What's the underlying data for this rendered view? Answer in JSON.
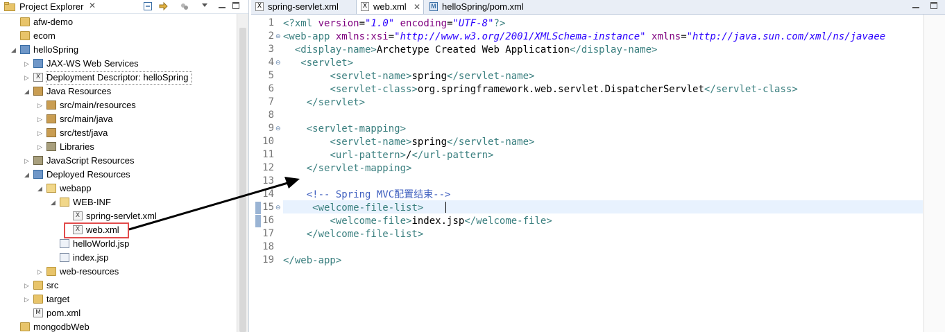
{
  "explorer": {
    "title": "Project Explorer",
    "close_glyph": "✕",
    "toolbar": [
      "collapse-all-icon",
      "link-with-editor-icon",
      "view-menu-icon",
      "minimize-icon",
      "maximize-icon"
    ],
    "items": [
      {
        "label": "afw-demo",
        "icon": "folder-icon",
        "indent": 0,
        "twisty": ""
      },
      {
        "label": "ecom",
        "icon": "folder-icon",
        "indent": 0,
        "twisty": ""
      },
      {
        "label": "helloSpring",
        "icon": "project-icon",
        "indent": 0,
        "twisty": "open"
      },
      {
        "label": "JAX-WS Web Services",
        "icon": "web-services-icon",
        "indent": 1,
        "twisty": "closed"
      },
      {
        "label": "Deployment Descriptor: helloSpring",
        "icon": "deployment-descriptor-icon",
        "indent": 1,
        "twisty": "closed"
      },
      {
        "label": "Java Resources",
        "icon": "java-resources-icon",
        "indent": 1,
        "twisty": "open"
      },
      {
        "label": "src/main/resources",
        "icon": "package-folder-icon",
        "indent": 2,
        "twisty": "closed"
      },
      {
        "label": "src/main/java",
        "icon": "package-folder-icon",
        "indent": 2,
        "twisty": "closed"
      },
      {
        "label": "src/test/java",
        "icon": "package-folder-icon",
        "indent": 2,
        "twisty": "closed"
      },
      {
        "label": "Libraries",
        "icon": "libraries-icon",
        "indent": 2,
        "twisty": "closed"
      },
      {
        "label": "JavaScript Resources",
        "icon": "javascript-resources-icon",
        "indent": 1,
        "twisty": "closed"
      },
      {
        "label": "Deployed Resources",
        "icon": "deployed-resources-icon",
        "indent": 1,
        "twisty": "open"
      },
      {
        "label": "webapp",
        "icon": "folder-open-icon",
        "indent": 2,
        "twisty": "open"
      },
      {
        "label": "WEB-INF",
        "icon": "folder-open-icon",
        "indent": 3,
        "twisty": "open"
      },
      {
        "label": "spring-servlet.xml",
        "icon": "xml-file-icon",
        "indent": 4,
        "twisty": ""
      },
      {
        "label": "web.xml",
        "icon": "xml-file-icon",
        "indent": 4,
        "twisty": ""
      },
      {
        "label": "helloWorld.jsp",
        "icon": "jsp-file-icon",
        "indent": 3,
        "twisty": ""
      },
      {
        "label": "index.jsp",
        "icon": "jsp-file-icon",
        "indent": 3,
        "twisty": ""
      },
      {
        "label": "web-resources",
        "icon": "folder-icon",
        "indent": 2,
        "twisty": "closed"
      },
      {
        "label": "src",
        "icon": "folder-icon",
        "indent": 1,
        "twisty": "closed"
      },
      {
        "label": "target",
        "icon": "folder-icon",
        "indent": 1,
        "twisty": "closed"
      },
      {
        "label": "pom.xml",
        "icon": "maven-pom-icon",
        "indent": 1,
        "twisty": ""
      },
      {
        "label": "mongodbWeb",
        "icon": "folder-icon",
        "indent": 0,
        "twisty": ""
      }
    ]
  },
  "editor": {
    "tabs": [
      {
        "label": "spring-servlet.xml",
        "icon": "xml-file-icon",
        "active": false
      },
      {
        "label": "web.xml",
        "icon": "xml-file-icon",
        "active": true
      },
      {
        "label": "helloSpring/pom.xml",
        "icon": "maven-pom-icon",
        "active": false
      }
    ],
    "tab_close_glyph": "✕",
    "window_controls": [
      "minimize-icon",
      "maximize-icon"
    ],
    "line_numbers": [
      "1",
      "2",
      "3",
      "4",
      "5",
      "6",
      "7",
      "8",
      "9",
      "10",
      "11",
      "12",
      "13",
      "14",
      "15",
      "16",
      "17",
      "18",
      "19"
    ],
    "fold_markers": [
      "2",
      "4",
      "9",
      "15"
    ],
    "current_line": "15",
    "lines": [
      [
        {
          "t": "pi",
          "v": "<?xml "
        },
        {
          "t": "at",
          "v": "version"
        },
        {
          "t": "tx",
          "v": "="
        },
        {
          "t": "av",
          "v": "\"1.0\""
        },
        {
          "t": "tx",
          "v": " "
        },
        {
          "t": "at",
          "v": "encoding"
        },
        {
          "t": "tx",
          "v": "="
        },
        {
          "t": "av",
          "v": "\"UTF-8\""
        },
        {
          "t": "tg",
          "v": "?>"
        }
      ],
      [
        {
          "t": "tg",
          "v": "<web-app "
        },
        {
          "t": "at",
          "v": "xmlns:xsi"
        },
        {
          "t": "tx",
          "v": "="
        },
        {
          "t": "av",
          "v": "\"http://www.w3.org/2001/XMLSchema-instance\""
        },
        {
          "t": "tx",
          "v": " "
        },
        {
          "t": "at",
          "v": "xmlns"
        },
        {
          "t": "tx",
          "v": "="
        },
        {
          "t": "av",
          "v": "\"http://java.sun.com/xml/ns/javaee"
        }
      ],
      [
        {
          "t": "tx",
          "v": "  "
        },
        {
          "t": "tg",
          "v": "<display-name>"
        },
        {
          "t": "tx",
          "v": "Archetype Created Web Application"
        },
        {
          "t": "tg",
          "v": "</display-name>"
        }
      ],
      [
        {
          "t": "tx",
          "v": "   "
        },
        {
          "t": "tg",
          "v": "<servlet>"
        }
      ],
      [
        {
          "t": "tx",
          "v": "        "
        },
        {
          "t": "tg",
          "v": "<servlet-name>"
        },
        {
          "t": "tx",
          "v": "spring"
        },
        {
          "t": "tg",
          "v": "</servlet-name>"
        }
      ],
      [
        {
          "t": "tx",
          "v": "        "
        },
        {
          "t": "tg",
          "v": "<servlet-class>"
        },
        {
          "t": "tx",
          "v": "org.springframework.web.servlet.DispatcherServlet"
        },
        {
          "t": "tg",
          "v": "</servlet-class>"
        }
      ],
      [
        {
          "t": "tx",
          "v": "    "
        },
        {
          "t": "tg",
          "v": "</servlet>"
        }
      ],
      [],
      [
        {
          "t": "tx",
          "v": "    "
        },
        {
          "t": "tg",
          "v": "<servlet-mapping>"
        }
      ],
      [
        {
          "t": "tx",
          "v": "        "
        },
        {
          "t": "tg",
          "v": "<servlet-name>"
        },
        {
          "t": "tx",
          "v": "spring"
        },
        {
          "t": "tg",
          "v": "</servlet-name>"
        }
      ],
      [
        {
          "t": "tx",
          "v": "        "
        },
        {
          "t": "tg",
          "v": "<url-pattern>"
        },
        {
          "t": "tx",
          "v": "/"
        },
        {
          "t": "tg",
          "v": "</url-pattern>"
        }
      ],
      [
        {
          "t": "tx",
          "v": "    "
        },
        {
          "t": "tg",
          "v": "</servlet-mapping>"
        }
      ],
      [],
      [
        {
          "t": "tx",
          "v": "    "
        },
        {
          "t": "cm",
          "v": "<!-- Spring MVC配置结束-->"
        }
      ],
      [
        {
          "t": "tx",
          "v": "     "
        },
        {
          "t": "tg",
          "v": "<welcome-file-list>"
        }
      ],
      [
        {
          "t": "tx",
          "v": "        "
        },
        {
          "t": "tg",
          "v": "<welcome-file>"
        },
        {
          "t": "tx",
          "v": "index.jsp"
        },
        {
          "t": "tg",
          "v": "</welcome-file>"
        }
      ],
      [
        {
          "t": "tx",
          "v": "    "
        },
        {
          "t": "tg",
          "v": "</welcome-file-list>"
        }
      ],
      [],
      [
        {
          "t": "tg",
          "v": "</web-app>"
        }
      ]
    ]
  },
  "colors": {
    "tag": "#3a7f7f",
    "attribute": "#7f007f",
    "attribute_value": "#2a00ff",
    "comment": "#3f5fbf",
    "highlight_box": "#e24b4b",
    "arrow": "#000000"
  }
}
